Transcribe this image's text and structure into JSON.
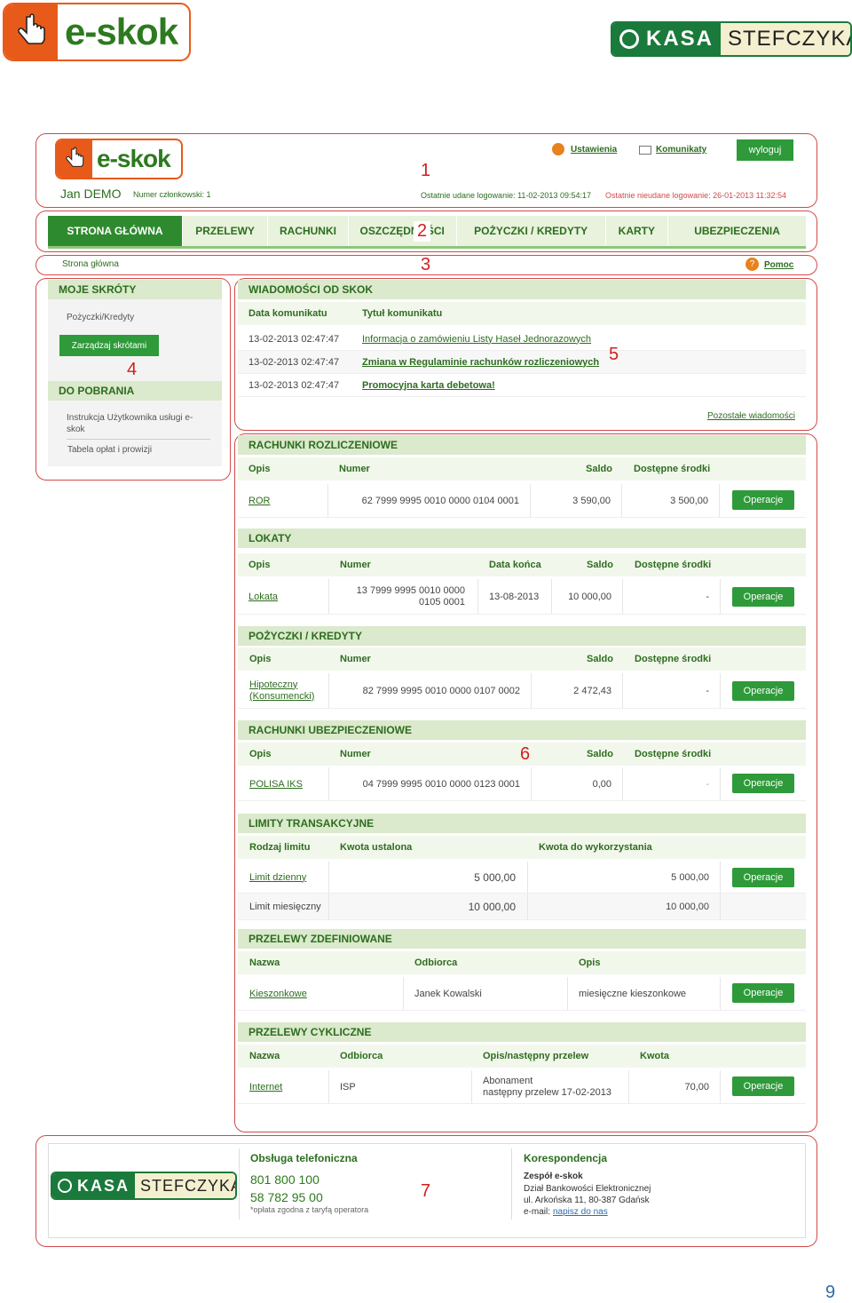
{
  "brand": {
    "eskok": "e-skok",
    "kasa": "KASA",
    "stefczyka": "STEFCZYKA"
  },
  "callouts": [
    "1",
    "2",
    "3",
    "4",
    "5",
    "6",
    "7"
  ],
  "page_number": "9",
  "header": {
    "settings": "Ustawienia",
    "messages": "Komunikaty",
    "logout": "wyloguj",
    "user_name": "Jan DEMO",
    "member_no": "Numer członkowski: 1",
    "last_login_ok": "Ostatnie udane logowanie: 11-02-2013 09:54:17",
    "last_login_fail": "Ostatnie nieudane logowanie: 26-01-2013 11:32:54"
  },
  "nav": [
    "STRONA GŁÓWNA",
    "PRZELEWY",
    "RACHUNKI",
    "OSZCZĘDNOŚCI",
    "POŻYCZKI / KREDYTY",
    "KARTY",
    "UBEZPIECZENIA"
  ],
  "breadcrumb": {
    "path": "Strona główna",
    "help": "Pomoc"
  },
  "sidebar": {
    "shortcuts_title": "MOJE SKRÓTY",
    "shortcut_item": "Pożyczki/Kredyty",
    "manage_button": "Zarządzaj skrótami",
    "downloads_title": "DO POBRANIA",
    "download_1": "Instrukcja Użytkownika usługi e-skok",
    "download_2": "Tabela opłat i prowizji"
  },
  "news": {
    "title": "WIADOMOŚCI OD SKOK",
    "col_date": "Data komunikatu",
    "col_title": "Tytuł komunikatu",
    "items": [
      {
        "date": "13-02-2013 02:47:47",
        "title": "Informacja o zamówieniu Listy Haseł Jednorazowych"
      },
      {
        "date": "13-02-2013 02:47:47",
        "title": "Zmiana w Regulaminie rachunków rozliczeniowych"
      },
      {
        "date": "13-02-2013 02:47:47",
        "title": "Promocyjna karta debetowa!"
      }
    ],
    "more": "Pozostałe wiadomości"
  },
  "operations_label": "Operacje",
  "accounts": {
    "title": "RACHUNKI ROZLICZENIOWE",
    "cols": [
      "Opis",
      "Numer",
      "Saldo",
      "Dostępne środki"
    ],
    "row": {
      "desc": "ROR",
      "number": "62 7999 9995 0010 0000 0104 0001",
      "balance": "3 590,00",
      "available": "3 500,00"
    }
  },
  "deposits": {
    "title": "LOKATY",
    "cols": [
      "Opis",
      "Numer",
      "Data końca",
      "Saldo",
      "Dostępne środki"
    ],
    "row": {
      "desc": "Lokata",
      "number_1": "13 7999 9995 0010 0000",
      "number_2": "0105 0001",
      "end_date": "13-08-2013",
      "balance": "10 000,00",
      "available": "-"
    }
  },
  "loans": {
    "title": "POŻYCZKI / KREDYTY",
    "cols": [
      "Opis",
      "Numer",
      "Saldo",
      "Dostępne środki"
    ],
    "row": {
      "desc_1": "Hipoteczny",
      "desc_2": "(Konsumencki)",
      "number": "82 7999 9995 0010 0000 0107 0002",
      "balance": "2 472,43",
      "available": "-"
    }
  },
  "insurance": {
    "title": "RACHUNKI UBEZPIECZENIOWE",
    "cols": [
      "Opis",
      "Numer",
      "Saldo",
      "Dostępne środki"
    ],
    "row": {
      "desc": "POLISA IKS",
      "number": "04 7999 9995 0010 0000 0123 0001",
      "balance": "0,00",
      "available": "-"
    }
  },
  "limits": {
    "title": "LIMITY TRANSAKCYJNE",
    "cols": [
      "Rodzaj limitu",
      "Kwota ustalona",
      "Kwota do wykorzystania"
    ],
    "rows": [
      {
        "type": "Limit dzienny",
        "set": "5 000,00",
        "avail": "5 000,00"
      },
      {
        "type": "Limit miesięczny",
        "set": "10 000,00",
        "avail": "10 000,00"
      }
    ]
  },
  "defined": {
    "title": "PRZELEWY ZDEFINIOWANE",
    "cols": [
      "Nazwa",
      "Odbiorca",
      "Opis"
    ],
    "row": {
      "name": "Kieszonkowe",
      "recipient": "Janek Kowalski",
      "desc": "miesięczne kieszonkowe"
    }
  },
  "cyclic": {
    "title": "PRZELEWY CYKLICZNE",
    "cols": [
      "Nazwa",
      "Odbiorca",
      "Opis/następny przelew",
      "Kwota"
    ],
    "row": {
      "name": "Internet",
      "recipient": "ISP",
      "desc_1": "Abonament",
      "desc_2": "następny przelew 17-02-2013",
      "amount": "70,00"
    }
  },
  "footer": {
    "phone_title": "Obsługa telefoniczna",
    "phone_1": "801 800 100",
    "phone_2": "58 782 95 00",
    "phone_note": "*opłata zgodna z taryfą operatora",
    "mail_title": "Korespondencja",
    "mail_team": "Zespół e-skok",
    "mail_dept": "Dział Bankowości Elektronicznej",
    "mail_addr": "ul. Arkońska 11, 80-387 Gdańsk",
    "mail_email_label": "e-mail:",
    "mail_email_link": "napisz do nas"
  },
  "colors": {
    "primary_green": "#2e8a2e",
    "orange": "#e85a19",
    "callout_red": "#d11f1f"
  }
}
